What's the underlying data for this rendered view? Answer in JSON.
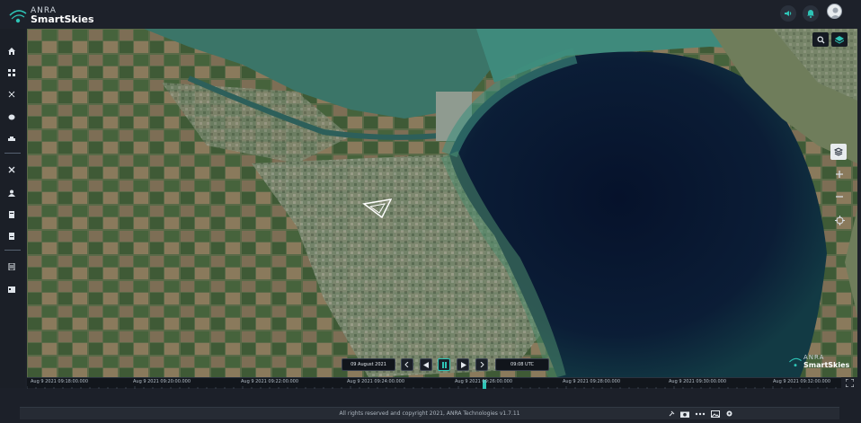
{
  "brand": {
    "line1": "ANRA",
    "line2": "SmartSkies"
  },
  "playback": {
    "date": "09 August 2021",
    "time": "09:08 UTC"
  },
  "timeline": {
    "labels": [
      "Aug 9 2021 09:18:00.000",
      "Aug 9 2021 09:20:00.000",
      "Aug 9 2021 09:22:00.000",
      "Aug 9 2021 09:24:00.000",
      "Aug 9 2021 09:26:00.000",
      "Aug 9 2021 09:28:00.000",
      "Aug 9 2021 09:30:00.000",
      "Aug 9 2021 09:32:00.000"
    ]
  },
  "footer": {
    "copyright": "All rights reserved and copyright 2021, ANRA Technologies v1.7.11"
  },
  "colors": {
    "accent": "#2ec4b6",
    "header": "#1d212a",
    "water_deep": "#0a1a33"
  }
}
